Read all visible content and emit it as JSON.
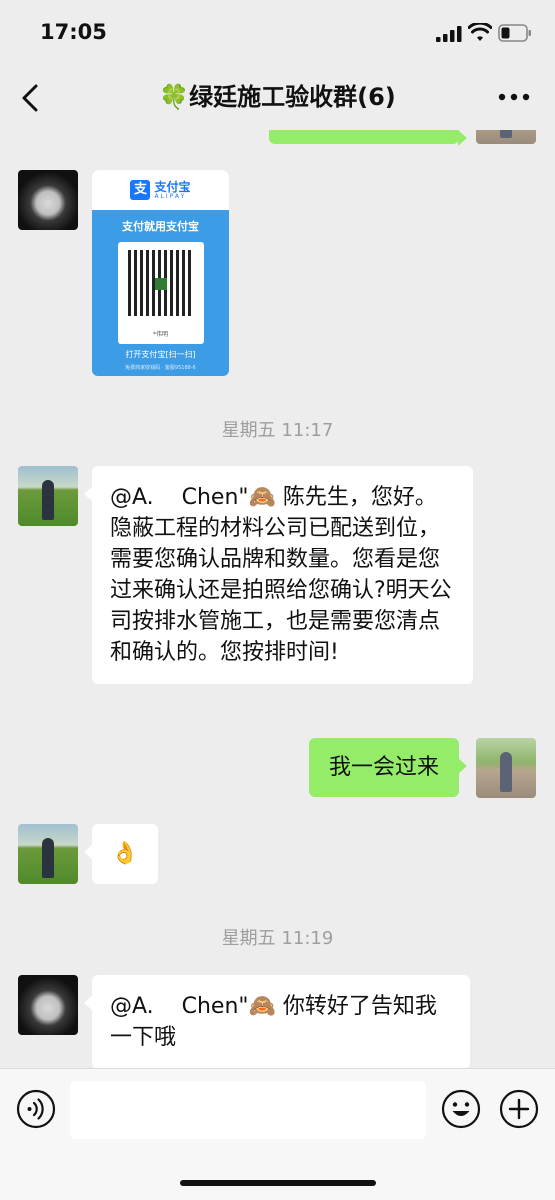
{
  "status_bar": {
    "time": "17:05"
  },
  "header": {
    "title": "🍀绿廷施工验收群(6)"
  },
  "messages": {
    "alipay": {
      "brand": "支付宝",
      "brand_en": "ALIPAY",
      "slogan": "支付就用支付宝",
      "qr_caption": "*伟明",
      "open_text": "打开支付宝[扫一扫]",
      "footer_text": "免费商家收钱码 · 客服95188-6"
    },
    "timestamp_1": "星期五 11:17",
    "msg_1": "@A.    Chen\"🙈 陈先生，您好。隐蔽工程的材料公司已配送到位，需要您确认品牌和数量。您看是您过来确认还是拍照给您确认?明天公司按排水管施工，也是需要您清点和确认的。您按排时间!",
    "msg_2": "我一会过来",
    "msg_3": "👌",
    "timestamp_2": "星期五 11:19",
    "msg_4": "@A.    Chen\"🙈 你转好了告知我一下哦"
  },
  "colors": {
    "outgoing_bubble": "#95ec69",
    "incoming_bubble": "#ffffff",
    "background": "#ededed"
  },
  "icons": [
    "back-arrow-icon",
    "more-dots-icon",
    "voice-icon",
    "emoji-icon",
    "plus-icon"
  ]
}
